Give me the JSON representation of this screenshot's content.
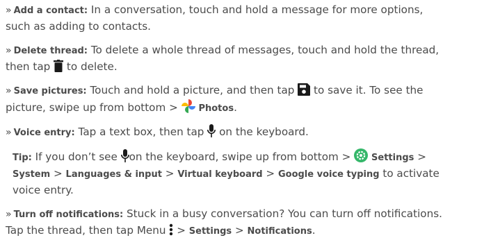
{
  "bullets": {
    "chevron": "»",
    "add_contact": {
      "term": "Add a contact:",
      "line1": " In a conversation, touch and hold a message for more options,",
      "line2": "such as adding to contacts."
    },
    "delete_thread": {
      "term": "Delete thread:",
      "line1": " To delete a whole thread of messages, touch and hold the thread,",
      "line2a": "then tap ",
      "line2b": " to delete."
    },
    "save_pictures": {
      "term": "Save pictures:",
      "line1a": " Touch and hold a picture, and then tap ",
      "line1b": " to save it. To see the",
      "line2a": "picture, swipe up from bottom > ",
      "photos": "Photos",
      "line2b": "."
    },
    "voice_entry": {
      "term": "Voice entry:",
      "line1a": " Tap a text box, then tap ",
      "line1b": " on the keyboard."
    },
    "tip": {
      "term": "Tip:",
      "line1a": " If you don’t see ",
      "line1b": "on the keyboard, swipe  up from bottom > ",
      "settings": "Settings",
      "line1c": " >",
      "system": "System",
      "sep1": " > ",
      "languages": "Languages & input",
      "sep2": " > ",
      "virtual_keyboard": "Virtual keyboard",
      "sep3": " > ",
      "google_voice": "Google voice typing",
      "line2end": " to activate",
      "line3": "voice entry."
    },
    "turn_off": {
      "term": "Turn off notifications:",
      "line1": " Stuck in a busy conversation? You can turn off notifications.",
      "line2a": "Tap the thread, then tap Menu ",
      "line2b": " > ",
      "settings": "Settings",
      "line2c": " > ",
      "notifications": "Notifications",
      "line2d": "."
    }
  },
  "icons": {
    "trash": "trash-icon",
    "save": "save-icon",
    "photos": "photos-app-icon",
    "mic": "microphone-icon",
    "settings": "settings-gear-icon",
    "menu": "menu-dots-icon"
  },
  "colors": {
    "text": "#4b4b4b",
    "icon": "#1a1a1a",
    "settings_green": "#35b76a"
  }
}
